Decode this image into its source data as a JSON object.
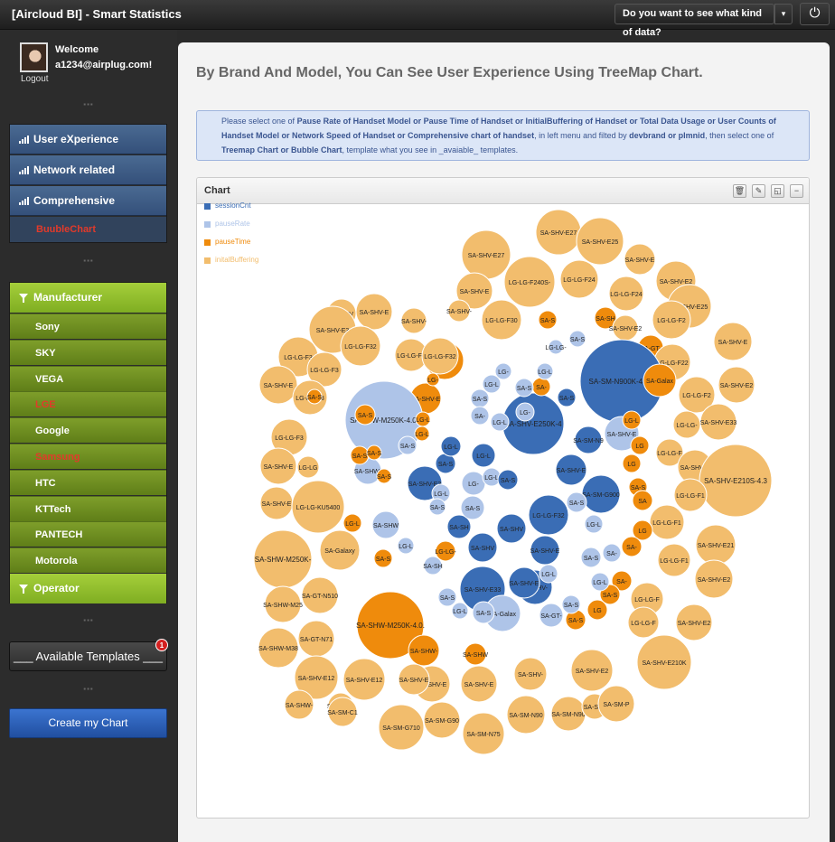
{
  "app": {
    "title": "[Aircloud BI] - Smart Statistics"
  },
  "topbar": {
    "dropdown_label": "Do you want to see what kind of data?",
    "caret": "▾",
    "power_icon": "⏻"
  },
  "user": {
    "welcome": "Welcome",
    "email": "a1234@airplug.com!",
    "logout": "Logout"
  },
  "nav": {
    "items": [
      "User eXperience",
      "Network related",
      "Comprehensive"
    ],
    "sub": "BuubleChart"
  },
  "filter": {
    "manufacturer_label": "Manufacturer",
    "manufacturers": [
      "Sony",
      "SKY",
      "VEGA",
      "LGE",
      "Google",
      "Samsung",
      "HTC",
      "KTTech",
      "PANTECH",
      "Motorola"
    ],
    "highlighted": [
      "LGE",
      "Samsung"
    ],
    "operator_label": "Operator"
  },
  "templates": {
    "label": "___ Available Templates ___",
    "badge": "1"
  },
  "create_button": "Create my Chart",
  "page": {
    "title": "By Brand And Model, You Can See User Experience Using TreeMap Chart.",
    "info_parts": [
      {
        "t": "Please select one of ",
        "b": false
      },
      {
        "t": "Pause Rate of Handset Model or Pause Time of Handset or InitialBuffering of Handset or Total Data Usage or User Counts of Handset Model or Network Speed of Handset or Comprehensive chart of handset",
        "b": true
      },
      {
        "t": ", in left menu and filted by ",
        "b": false
      },
      {
        "t": "devbrand or plmnid",
        "b": true
      },
      {
        "t": ", then select one of ",
        "b": false
      },
      {
        "t": "Treemap Chart or Bubble Chart",
        "b": true
      },
      {
        "t": ", template what you see in _avaiable_ templates.",
        "b": false
      }
    ]
  },
  "chart": {
    "title": "Chart",
    "tools": [
      "trash-icon",
      "edit-icon",
      "expand-icon",
      "minimize-icon"
    ],
    "legend": [
      {
        "name": "sessionCnt",
        "color": "#3a6db5"
      },
      {
        "name": "pauseRate",
        "color": "#aec4e8"
      },
      {
        "name": "pauseTime",
        "color": "#ef8b0c"
      },
      {
        "name": "initalBuffering",
        "color": "#f2bd6d"
      }
    ]
  },
  "chart_data": {
    "type": "bubble",
    "series_colors": {
      "sessionCnt": "#3a6db5",
      "pauseRate": "#aec4e8",
      "pauseTime": "#ef8b0c",
      "initalBuffering": "#f2bd6d"
    },
    "bubbles": [
      {
        "label": "SA-SHV-E27",
        "series": "initalBuffering"
      },
      {
        "label": "SA-SHV-E25",
        "series": "initalBuffering"
      },
      {
        "label": "SA-SHV-E27",
        "series": "initalBuffering"
      },
      {
        "label": "SA-SHV-E",
        "series": "initalBuffering"
      },
      {
        "label": "LG-LG-F240S-",
        "series": "initalBuffering"
      },
      {
        "label": "LG-LG-F24",
        "series": "initalBuffering"
      },
      {
        "label": "SA-SHV-E2",
        "series": "initalBuffering"
      },
      {
        "label": "SA-SHV-E",
        "series": "initalBuffering"
      },
      {
        "label": "LG-LG-F24",
        "series": "initalBuffering"
      },
      {
        "label": "SA-SHV-E25",
        "series": "initalBuffering"
      },
      {
        "label": "SA-SHV",
        "series": "initalBuffering"
      },
      {
        "label": "SA-SHV-E",
        "series": "initalBuffering"
      },
      {
        "label": "SA-SHV-",
        "series": "initalBuffering"
      },
      {
        "label": "SA-SHV-",
        "series": "initalBuffering"
      },
      {
        "label": "LG-LG-F30",
        "series": "initalBuffering"
      },
      {
        "label": "SA-S",
        "series": "pauseTime"
      },
      {
        "label": "SA-SH",
        "series": "pauseTime"
      },
      {
        "label": "LG-LG-F2",
        "series": "initalBuffering"
      },
      {
        "label": "SA-SHV-E3",
        "series": "initalBuffering"
      },
      {
        "label": "LG-LG-F32",
        "series": "initalBuffering"
      },
      {
        "label": "LG-LG-F3",
        "series": "initalBuffering"
      },
      {
        "label": "SA-GT-",
        "series": "pauseTime"
      },
      {
        "label": "SA-SHV-E2",
        "series": "initalBuffering"
      },
      {
        "label": "SA-SHV-E",
        "series": "initalBuffering"
      },
      {
        "label": "LG-LG-F3",
        "series": "initalBuffering"
      },
      {
        "label": "LG-LG-F32",
        "series": "initalBuffering"
      },
      {
        "label": "SA-GT-",
        "series": "pauseTime"
      },
      {
        "label": "LG-LG-F22",
        "series": "initalBuffering"
      },
      {
        "label": "LG-LG-F3",
        "series": "initalBuffering"
      },
      {
        "label": "SA-SM-N900K-4.4.2",
        "series": "sessionCnt"
      },
      {
        "label": "SA-Galax",
        "series": "pauseTime"
      },
      {
        "label": "SA-SHV-E2",
        "series": "initalBuffering"
      },
      {
        "label": "SA-SHV-E",
        "series": "initalBuffering"
      },
      {
        "label": "LG-LG-F3",
        "series": "initalBuffering"
      },
      {
        "label": "SA-S",
        "series": "pauseTime"
      },
      {
        "label": "SA-SHV-E",
        "series": "pauseTime"
      },
      {
        "label": "LG-LG-F2",
        "series": "initalBuffering"
      },
      {
        "label": "SA-SHW-M250K-4.0.",
        "series": "pauseRate"
      },
      {
        "label": "SA-SHV-E250K-4",
        "series": "sessionCnt"
      },
      {
        "label": "SA-SHV-E33",
        "series": "initalBuffering"
      },
      {
        "label": "LG-LG-F3",
        "series": "initalBuffering"
      },
      {
        "label": "SA-SM-N9",
        "series": "sessionCnt"
      },
      {
        "label": "SA-SHV-E",
        "series": "pauseRate"
      },
      {
        "label": "LG-LG-",
        "series": "initalBuffering"
      },
      {
        "label": "SA-SHV-E",
        "series": "initalBuffering"
      },
      {
        "label": "LG-LG-F",
        "series": "initalBuffering"
      },
      {
        "label": "SA-SHV-E",
        "series": "initalBuffering"
      },
      {
        "label": "LG-LG",
        "series": "initalBuffering"
      },
      {
        "label": "SA-SHW-",
        "series": "pauseRate"
      },
      {
        "label": "SA-SHV-E3",
        "series": "sessionCnt"
      },
      {
        "label": "SA-SHV-E",
        "series": "sessionCnt"
      },
      {
        "label": "SA-SM-G900",
        "series": "sessionCnt"
      },
      {
        "label": "SA-SHV-E210S-4.3",
        "series": "initalBuffering"
      },
      {
        "label": "LG-LG-F1",
        "series": "initalBuffering"
      },
      {
        "label": "SA-SHV-E",
        "series": "initalBuffering"
      },
      {
        "label": "LG-LG-KU5400",
        "series": "initalBuffering"
      },
      {
        "label": "LG-LG-F32",
        "series": "sessionCnt"
      },
      {
        "label": "LG-LG-F1",
        "series": "initalBuffering"
      },
      {
        "label": "SA-SHV-E21",
        "series": "initalBuffering"
      },
      {
        "label": "SA-SHW-M250K-",
        "series": "initalBuffering"
      },
      {
        "label": "SA-Galaxy",
        "series": "initalBuffering"
      },
      {
        "label": "SA-SHW",
        "series": "pauseRate"
      },
      {
        "label": "SA-SH",
        "series": "sessionCnt"
      },
      {
        "label": "SA-SHV",
        "series": "sessionCnt"
      },
      {
        "label": "SA-SHV-E",
        "series": "sessionCnt"
      },
      {
        "label": "SA-SHV-",
        "series": "sessionCnt"
      },
      {
        "label": "SA-SHV",
        "series": "sessionCnt"
      },
      {
        "label": "LG-LG-F1",
        "series": "initalBuffering"
      },
      {
        "label": "SA-SHV-E2",
        "series": "initalBuffering"
      },
      {
        "label": "SA-GT-N510",
        "series": "initalBuffering"
      },
      {
        "label": "SA-SHV-E33",
        "series": "sessionCnt"
      },
      {
        "label": "SA-SHV-E",
        "series": "sessionCnt"
      },
      {
        "label": "LG-LG-F",
        "series": "initalBuffering"
      },
      {
        "label": "SA-SHW-M25",
        "series": "initalBuffering"
      },
      {
        "label": "SA-SHW-M250K-4.0.",
        "series": "pauseTime"
      },
      {
        "label": "SA-Galax",
        "series": "pauseRate"
      },
      {
        "label": "SA-GT-",
        "series": "pauseRate"
      },
      {
        "label": "LG-LG-F",
        "series": "initalBuffering"
      },
      {
        "label": "SA-SHV-E2",
        "series": "initalBuffering"
      },
      {
        "label": "SA-GT-N71",
        "series": "initalBuffering"
      },
      {
        "label": "SA-SHW-M38",
        "series": "initalBuffering"
      },
      {
        "label": "SA-SHW-",
        "series": "pauseTime"
      },
      {
        "label": "SA-SHW",
        "series": "pauseTime"
      },
      {
        "label": "SA-SHV-E210K",
        "series": "initalBuffering"
      },
      {
        "label": "SA-SHV-E12",
        "series": "initalBuffering"
      },
      {
        "label": "SA-SHV-E12",
        "series": "initalBuffering"
      },
      {
        "label": "SA-SHV-E",
        "series": "initalBuffering"
      },
      {
        "label": "SA-SHV-E",
        "series": "initalBuffering"
      },
      {
        "label": "SA-SHV-",
        "series": "initalBuffering"
      },
      {
        "label": "SA-SHV-E2",
        "series": "initalBuffering"
      },
      {
        "label": "SA-SHW-",
        "series": "initalBuffering"
      },
      {
        "label": "SA-SHW-",
        "series": "initalBuffering"
      },
      {
        "label": "SA-SM-C1",
        "series": "initalBuffering"
      },
      {
        "label": "SA-SHV-E",
        "series": "initalBuffering"
      },
      {
        "label": "SA-SM-G710",
        "series": "initalBuffering"
      },
      {
        "label": "SA-SM-G90",
        "series": "initalBuffering"
      },
      {
        "label": "SA-SM-N90",
        "series": "initalBuffering"
      },
      {
        "label": "SA-SM-N90",
        "series": "initalBuffering"
      },
      {
        "label": "SA-SM-",
        "series": "initalBuffering"
      },
      {
        "label": "SA-SM-P",
        "series": "initalBuffering"
      },
      {
        "label": "SA-SM-N75",
        "series": "initalBuffering"
      },
      {
        "label": "SA-S",
        "series": "pauseTime"
      },
      {
        "label": "SA-S",
        "series": "pauseTime"
      },
      {
        "label": "SA-S",
        "series": "pauseTime"
      },
      {
        "label": "LG-L",
        "series": "pauseTime"
      },
      {
        "label": "LG-L",
        "series": "pauseTime"
      },
      {
        "label": "LG-",
        "series": "pauseTime"
      },
      {
        "label": "SA-S",
        "series": "pauseTime"
      },
      {
        "label": "LG-L",
        "series": "pauseTime"
      },
      {
        "label": "SA-S",
        "series": "pauseTime"
      },
      {
        "label": "LG-LG-",
        "series": "pauseTime"
      },
      {
        "label": "SA-",
        "series": "pauseTime"
      },
      {
        "label": "LG-L",
        "series": "pauseTime"
      },
      {
        "label": "LG",
        "series": "pauseTime"
      },
      {
        "label": "LG",
        "series": "pauseTime"
      },
      {
        "label": "SA-S",
        "series": "pauseTime"
      },
      {
        "label": "SA",
        "series": "pauseTime"
      },
      {
        "label": "LG",
        "series": "pauseTime"
      },
      {
        "label": "SA-",
        "series": "pauseTime"
      },
      {
        "label": "SA-",
        "series": "pauseTime"
      },
      {
        "label": "SA-S",
        "series": "pauseTime"
      },
      {
        "label": "LG",
        "series": "pauseTime"
      },
      {
        "label": "SA-S",
        "series": "pauseTime"
      },
      {
        "label": "SA-S",
        "series": "pauseRate"
      },
      {
        "label": "SA-",
        "series": "pauseRate"
      },
      {
        "label": "LG-L",
        "series": "pauseRate"
      },
      {
        "label": "SA-S",
        "series": "pauseRate"
      },
      {
        "label": "LG-L",
        "series": "pauseRate"
      },
      {
        "label": "LG-",
        "series": "pauseRate"
      },
      {
        "label": "SA-S",
        "series": "pauseRate"
      },
      {
        "label": "LG-LG-",
        "series": "pauseRate"
      },
      {
        "label": "LG-L",
        "series": "pauseRate"
      },
      {
        "label": "SA-S",
        "series": "pauseRate"
      },
      {
        "label": "LG-",
        "series": "pauseRate"
      },
      {
        "label": "LG-L",
        "series": "pauseRate"
      },
      {
        "label": "SA-S",
        "series": "pauseRate"
      },
      {
        "label": "LG-L",
        "series": "pauseRate"
      },
      {
        "label": "SA-SH",
        "series": "pauseRate"
      },
      {
        "label": "SA-S",
        "series": "pauseRate"
      },
      {
        "label": "LG-L",
        "series": "pauseRate"
      },
      {
        "label": "SA-S",
        "series": "pauseRate"
      },
      {
        "label": "LG-L",
        "series": "pauseRate"
      },
      {
        "label": "SA-S",
        "series": "pauseRate"
      },
      {
        "label": "SA-S",
        "series": "pauseRate"
      },
      {
        "label": "LG-L",
        "series": "pauseRate"
      },
      {
        "label": "SA-",
        "series": "pauseRate"
      },
      {
        "label": "LG-L",
        "series": "pauseRate"
      },
      {
        "label": "SA-S",
        "series": "pauseRate"
      },
      {
        "label": "LG-",
        "series": "pauseRate"
      },
      {
        "label": "SA-S",
        "series": "pauseRate"
      },
      {
        "label": "LG-L",
        "series": "pauseRate"
      },
      {
        "label": "SA-S",
        "series": "sessionCnt"
      },
      {
        "label": "LG-L",
        "series": "sessionCnt"
      },
      {
        "label": "SA-S",
        "series": "sessionCnt"
      },
      {
        "label": "LG-L",
        "series": "sessionCnt"
      },
      {
        "label": "SA-S",
        "series": "sessionCnt"
      },
      {
        "label": "LG-L",
        "series": "sessionCnt"
      },
      {
        "label": "SA-S",
        "series": "sessionCnt"
      },
      {
        "label": "SA-S",
        "series": "sessionCnt"
      }
    ]
  }
}
